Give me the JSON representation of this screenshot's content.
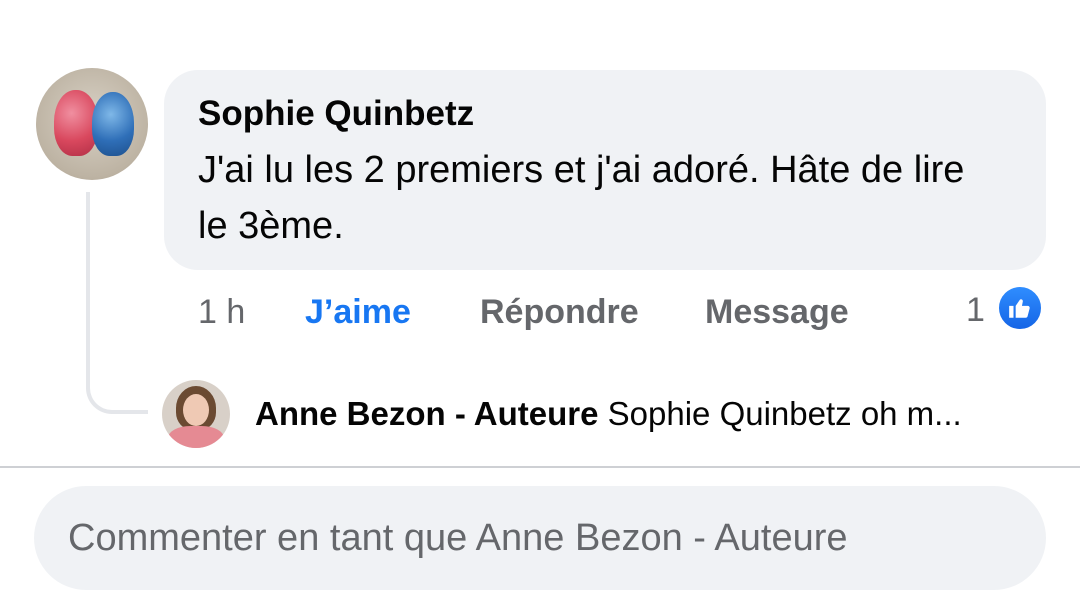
{
  "comment": {
    "author": "Sophie Quinbetz",
    "text": "J'ai lu les 2 premiers et j'ai adoré. Hâte de lire le 3ème.",
    "time": "1 h",
    "actions": {
      "like": "J’aime",
      "reply": "Répondre",
      "message": "Message"
    },
    "reaction_count": "1",
    "reaction_icon": "thumbs-up-icon",
    "accent_color": "#1877f2"
  },
  "reply": {
    "author": "Anne Bezon - Auteure",
    "text_preview": "Sophie Quinbetz oh m..."
  },
  "composer": {
    "placeholder": "Commenter en tant que Anne Bezon - Auteure"
  }
}
